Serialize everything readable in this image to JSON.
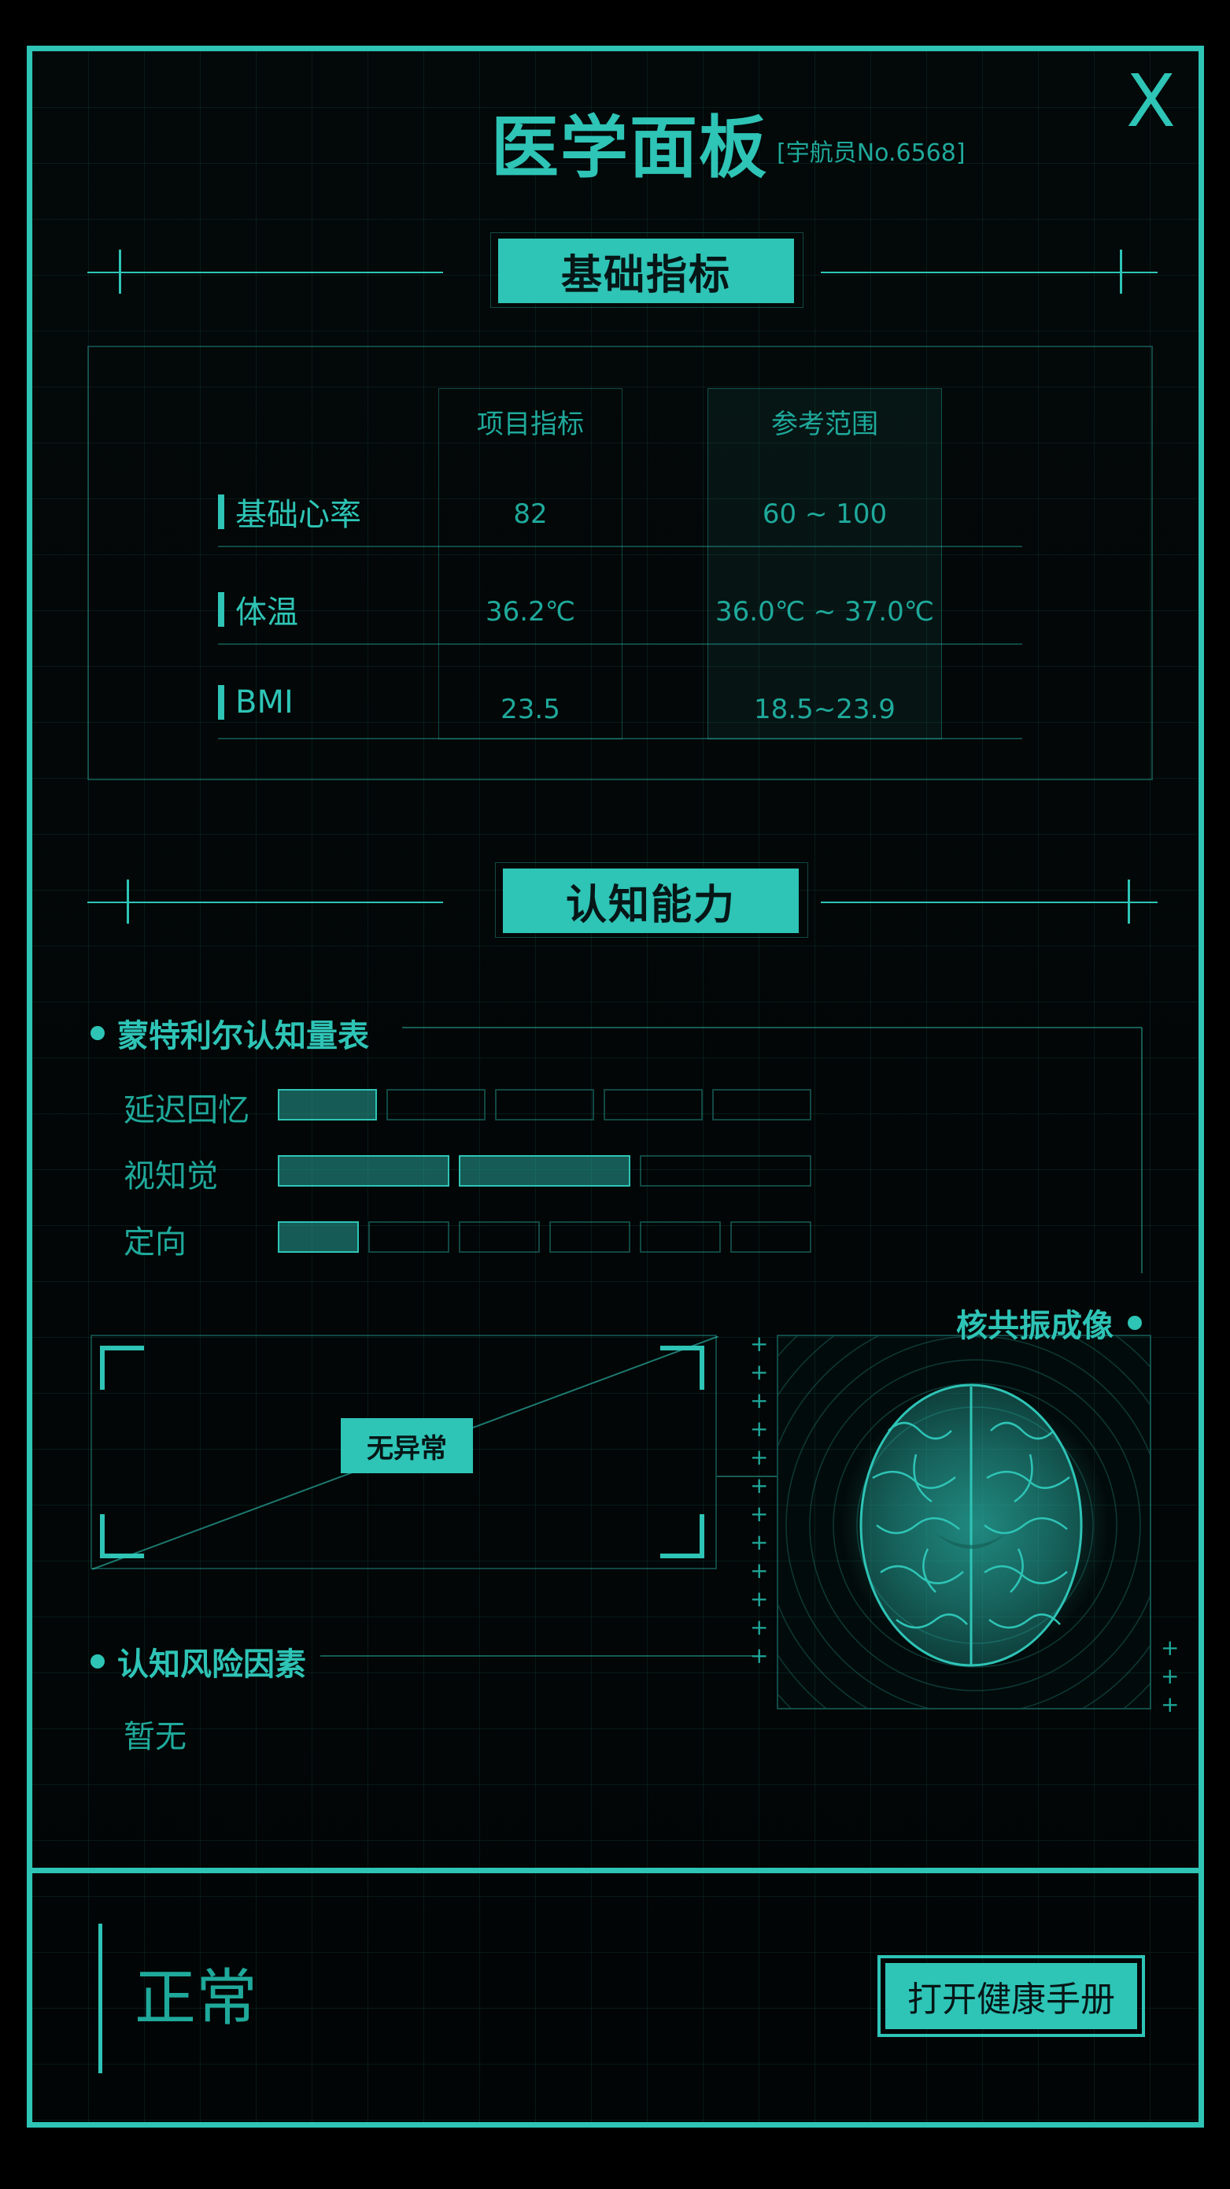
{
  "panel": {
    "title": "医学面板",
    "subtitle": "[宇航员No.6568]",
    "close_label": "X"
  },
  "basic": {
    "section_label": "基础指标",
    "columns": [
      "项目指标",
      "参考范围"
    ],
    "rows": [
      {
        "label": "基础心率",
        "value": "82",
        "range": "60 ~ 100"
      },
      {
        "label": "体温",
        "value": "36.2℃",
        "range": "36.0℃ ~ 37.0℃"
      },
      {
        "label": "BMI",
        "value": "23.5",
        "range": "18.5~23.9"
      }
    ]
  },
  "cognitive": {
    "section_label": "认知能力",
    "scale_title": "蒙特利尔认知量表",
    "scales": [
      {
        "label": "延迟回忆",
        "filled": 1,
        "total": 5
      },
      {
        "label": "视知觉",
        "filled": 2,
        "total": 3
      },
      {
        "label": "定向",
        "filled": 1,
        "total": 6
      }
    ],
    "mri_title": "核共振成像",
    "mri_result": "无异常",
    "risk_title": "认知风险因素",
    "risk_value": "暂无"
  },
  "footer": {
    "status": "正常",
    "open_button": "打开健康手册"
  },
  "colors": {
    "accent": "#2ec4b6",
    "background": "#000000"
  },
  "icons": {
    "close": "close-icon",
    "brain": "brain-icon"
  }
}
